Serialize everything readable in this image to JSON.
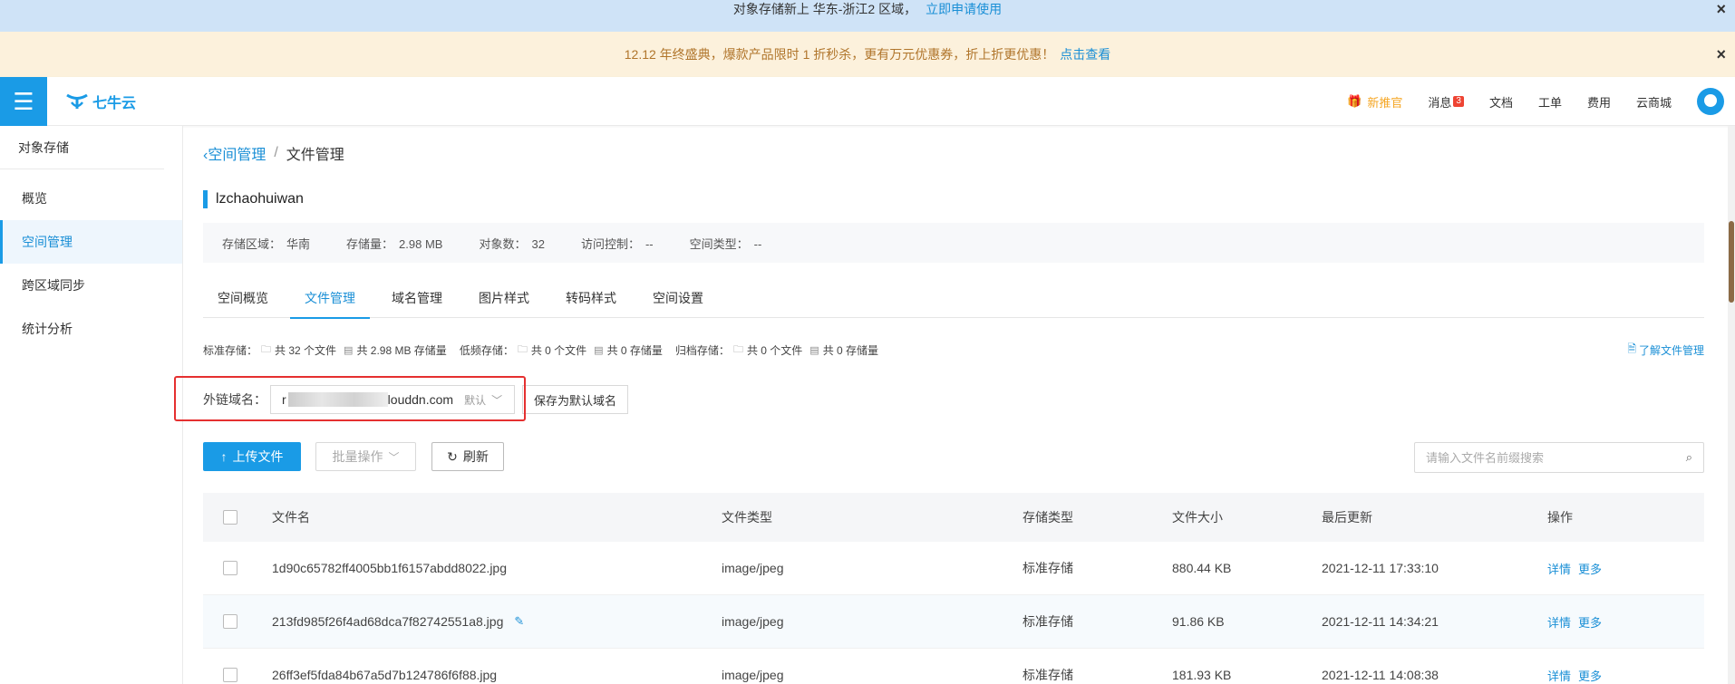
{
  "banner_top": {
    "text": "对象存储新上 华东-浙江2 区域，",
    "link": "立即申请使用",
    "close": "×"
  },
  "banner_promo": {
    "text": "12.12 年终盛典，爆款产品限时 1 折秒杀，更有万元优惠券，折上折更优惠！",
    "link": "点击查看",
    "close": "×"
  },
  "topnav": {
    "logo": "七牛云",
    "items": [
      {
        "label": "新推官",
        "icon": "gift-icon"
      },
      {
        "label": "消息",
        "badge": "3"
      },
      {
        "label": "文档"
      },
      {
        "label": "工单"
      },
      {
        "label": "费用"
      },
      {
        "label": "云商城"
      }
    ]
  },
  "sidebar": {
    "title": "对象存储",
    "items": [
      {
        "label": "概览",
        "active": false
      },
      {
        "label": "空间管理",
        "active": true
      },
      {
        "label": "跨区域同步",
        "active": false
      },
      {
        "label": "统计分析",
        "active": false
      }
    ]
  },
  "breadcrumb": {
    "back": "空间管理",
    "sep": "/",
    "current": "文件管理"
  },
  "bucket": {
    "name": "lzchaohuiwan"
  },
  "info": [
    {
      "label": "存储区域：",
      "value": "华南"
    },
    {
      "label": "存储量：",
      "value": "2.98 MB"
    },
    {
      "label": "对象数：",
      "value": "32"
    },
    {
      "label": "访问控制：",
      "value": "--"
    },
    {
      "label": "空间类型：",
      "value": "--"
    }
  ],
  "tabs": [
    {
      "label": "空间概览",
      "active": false
    },
    {
      "label": "文件管理",
      "active": true
    },
    {
      "label": "域名管理",
      "active": false
    },
    {
      "label": "图片样式",
      "active": false
    },
    {
      "label": "转码样式",
      "active": false
    },
    {
      "label": "空间设置",
      "active": false
    }
  ],
  "stats": [
    {
      "label": "标准存储：",
      "files": "共 32 个文件",
      "storage": "共 2.98 MB 存储量"
    },
    {
      "label": "低频存储：",
      "files": "共 0 个文件",
      "storage": "共 0 存储量"
    },
    {
      "label": "归档存储：",
      "files": "共 0 个文件",
      "storage": "共 0 存储量"
    }
  ],
  "learn_link": "了解文件管理",
  "domain": {
    "label": "外链域名：",
    "prefix": "r",
    "suffix": "louddn.com",
    "tag": "默认",
    "save_label": "保存为默认域名"
  },
  "toolbar": {
    "upload_label": "上传文件",
    "batch_label": "批量操作",
    "refresh_label": "刷新",
    "search_placeholder": "请输入文件名前缀搜索"
  },
  "table": {
    "headers": [
      "文件名",
      "文件类型",
      "存储类型",
      "文件大小",
      "最后更新",
      "操作"
    ],
    "rows": [
      {
        "name": "1d90c65782ff4005bb1f6157abdd8022.jpg",
        "type": "image/jpeg",
        "store": "标准存储",
        "size": "880.44 KB",
        "time": "2021-12-11 17:33:10",
        "op1": "详情",
        "op2": "更多"
      },
      {
        "name": "213fd985f26f4ad68dca7f82742551a8.jpg",
        "type": "image/jpeg",
        "store": "标准存储",
        "size": "91.86 KB",
        "time": "2021-12-11 14:34:21",
        "op1": "详情",
        "op2": "更多"
      },
      {
        "name": "26ff3ef5fda84b67a5d7b124786f6f88.jpg",
        "type": "image/jpeg",
        "store": "标准存储",
        "size": "181.93 KB",
        "time": "2021-12-11 14:08:38",
        "op1": "详情",
        "op2": "更多"
      }
    ]
  }
}
